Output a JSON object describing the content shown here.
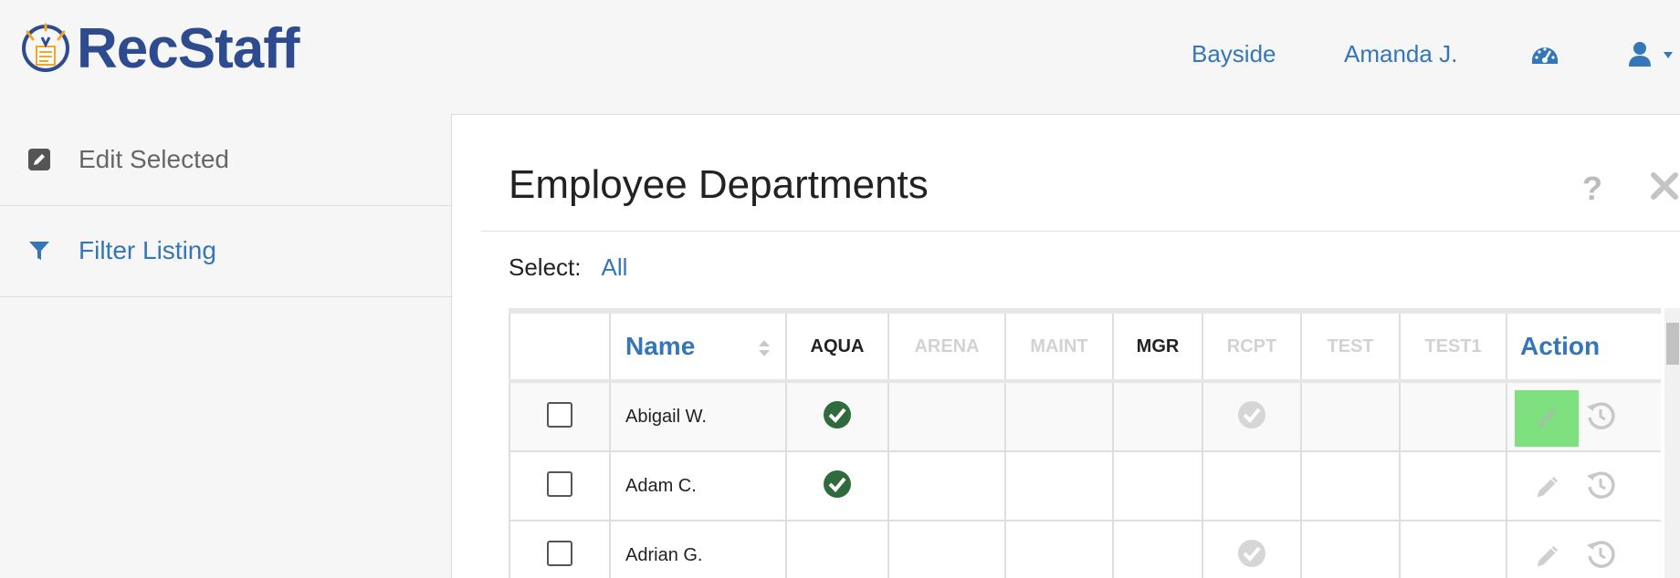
{
  "brand": {
    "name": "RecStaff"
  },
  "nav": {
    "location": "Bayside",
    "user": "Amanda J.",
    "dashboard_icon": "dashboard-icon",
    "profile_icon": "user-icon"
  },
  "sidebar": {
    "items": [
      {
        "label": "Edit Selected",
        "icon": "edit-icon",
        "color": "#666666"
      },
      {
        "label": "Filter Listing",
        "icon": "filter-icon",
        "color": "#3576b8"
      }
    ]
  },
  "panel": {
    "title": "Employee Departments",
    "help": "?",
    "select_label": "Select:",
    "select_all": "All"
  },
  "table": {
    "name_header": "Name",
    "action_header": "Action",
    "departments": [
      {
        "code": "AQUA",
        "active": true
      },
      {
        "code": "ARENA",
        "active": false
      },
      {
        "code": "MAINT",
        "active": false
      },
      {
        "code": "MGR",
        "active": true
      },
      {
        "code": "RCPT",
        "active": false
      },
      {
        "code": "TEST",
        "active": false
      },
      {
        "code": "TEST1",
        "active": false
      }
    ],
    "rows": [
      {
        "name": "Abigail W.",
        "AQUA": "assigned",
        "RCPT": "inactive-assigned",
        "edit_highlighted": true
      },
      {
        "name": "Adam C.",
        "AQUA": "assigned"
      },
      {
        "name": "Adrian G.",
        "RCPT": "inactive-assigned"
      }
    ]
  },
  "colors": {
    "link": "#3576b8",
    "brand": "#2d4b8e",
    "check_active": "#2f6b3c",
    "check_inactive": "#d6d6d6",
    "edit_highlight": "#7fe07f"
  }
}
